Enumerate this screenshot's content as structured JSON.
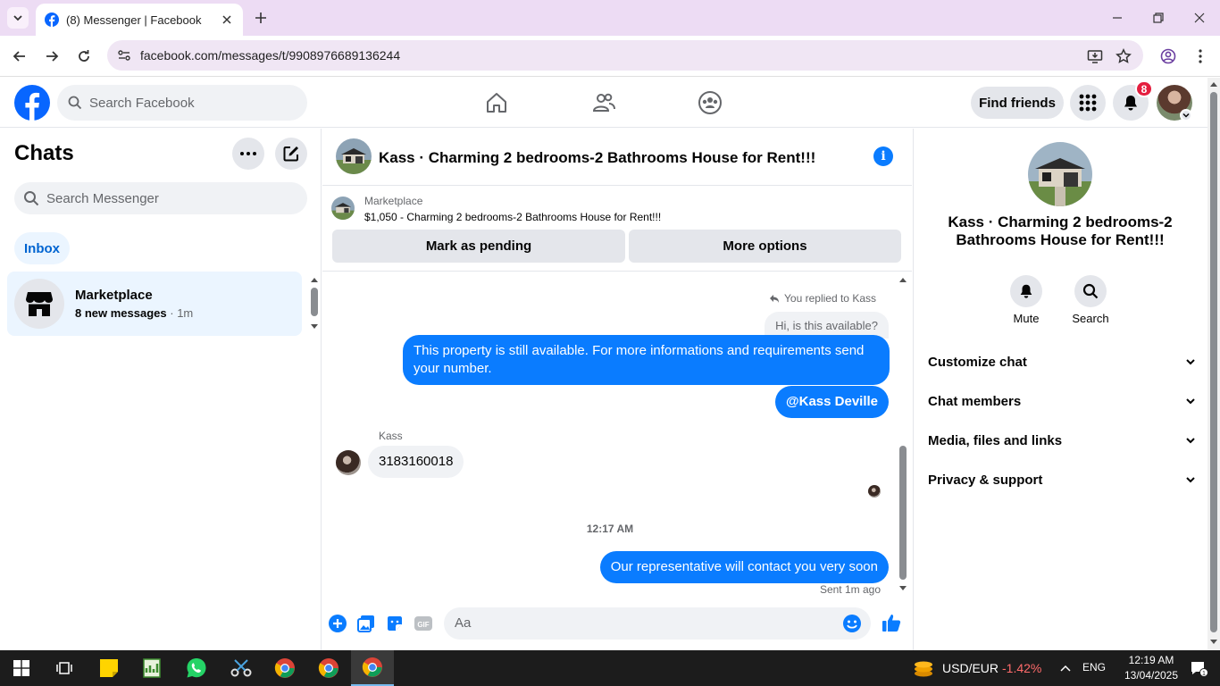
{
  "browser": {
    "tab_title": "(8) Messenger | Facebook",
    "url": "facebook.com/messages/t/9908976689136244"
  },
  "fb": {
    "search_placeholder": "Search Facebook",
    "find_friends": "Find friends",
    "notification_count": "8"
  },
  "chats": {
    "title": "Chats",
    "search_placeholder": "Search Messenger",
    "inbox_label": "Inbox",
    "items": [
      {
        "name": "Marketplace",
        "unread": "8 new messages",
        "time": "1m"
      }
    ]
  },
  "conversation": {
    "title": "Kass · Charming 2 bedrooms-2 Bathrooms House for Rent!!!",
    "marketplace_label": "Marketplace",
    "listing_title": "$1,050 - Charming 2 bedrooms-2 Bathrooms House for Rent!!!",
    "mark_pending": "Mark as pending",
    "more_options": "More options",
    "replied_to": "You replied to Kass",
    "quoted_text": "Hi, is this available?",
    "messages": [
      {
        "text": "This property is still available. For more informations and requirements send your number."
      },
      {
        "text": "@Kass Deville"
      },
      {
        "sender": "Kass",
        "text": "3183160018"
      },
      {
        "text": "Our representative will contact you very soon"
      }
    ],
    "timestamp": "12:17 AM",
    "sent_status": "Sent 1m ago",
    "composer_placeholder": "Aa"
  },
  "details": {
    "name": "Kass · Charming 2 bedrooms-2 Bathrooms House for Rent!!!",
    "mute_label": "Mute",
    "search_label": "Search",
    "sections": [
      "Customize chat",
      "Chat members",
      "Media, files and links",
      "Privacy & support"
    ]
  },
  "taskbar": {
    "ticker": "USD/EUR",
    "change": "-1.42%",
    "lang": "ENG",
    "time": "12:19 AM",
    "date": "13/04/2025",
    "notif_count": "1"
  },
  "colors": {
    "fb_blue": "#0866ff",
    "bubble_blue": "#0a7cff",
    "badge_red": "#e41e3f",
    "ticker_red": "#ff6b6b"
  }
}
